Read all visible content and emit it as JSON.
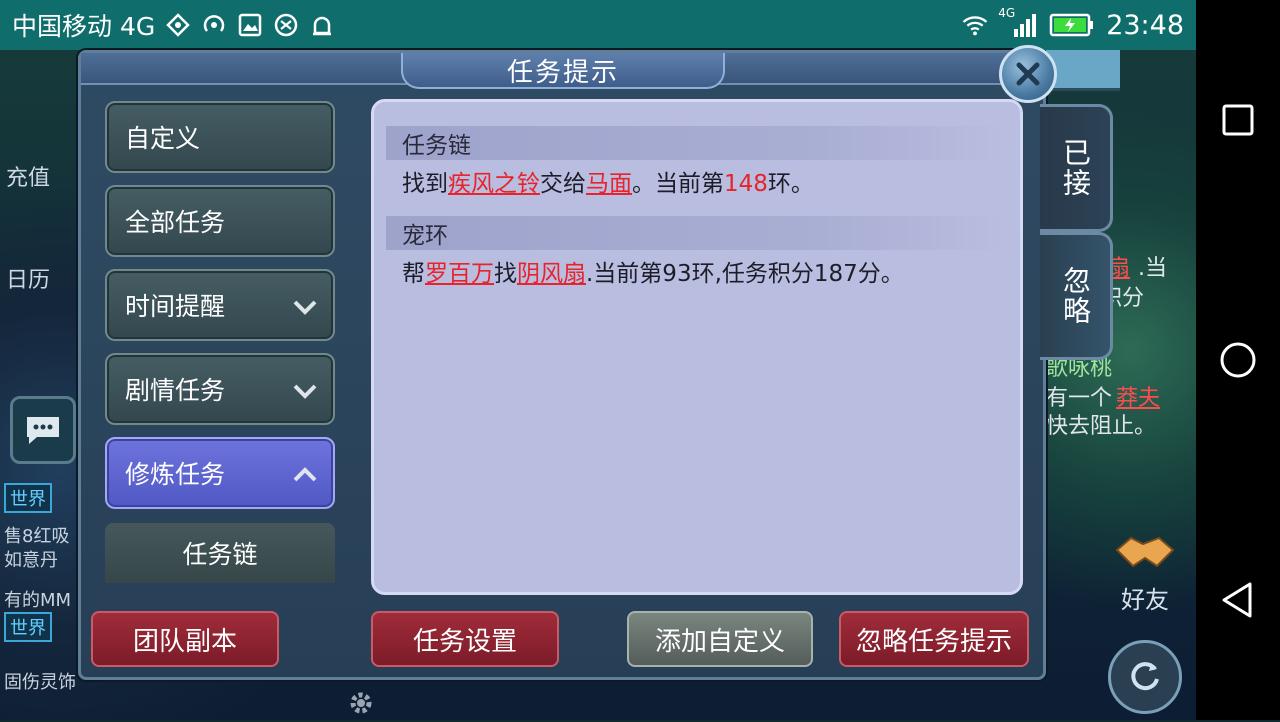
{
  "status_bar": {
    "carrier": "中国移动 4G",
    "network_badge": "4G",
    "time": "23:48",
    "icons": [
      "data-sync-icon",
      "hotspot-icon",
      "image-icon",
      "vpn-icon",
      "android-debug-icon",
      "wifi-icon",
      "signal-icon",
      "battery-charging-icon"
    ]
  },
  "dialog": {
    "title": "任务提示",
    "menu": {
      "custom": "自定义",
      "all_tasks": "全部任务",
      "time_reminder": "时间提醒",
      "story_tasks": "剧情任务",
      "cultivation_tasks": "修炼任务",
      "sub_task_chain": "任务链"
    },
    "sections": [
      {
        "head": "任务链",
        "parts": {
          "p1": "找到",
          "item": "疾风之铃",
          "p2": "交给",
          "npc": "马面",
          "p3": "。当前第",
          "num": "148",
          "p4": "环。"
        }
      },
      {
        "head": "宠环",
        "parts": {
          "p1": "帮",
          "npc": "罗百万",
          "p2": "找",
          "item": "阴风扇",
          "p3": ".当前第93环,任务积分187分。"
        }
      }
    ],
    "side_tabs": {
      "accepted": "已接",
      "ignored": "忽略"
    },
    "buttons": {
      "team_dungeon": "团队副本",
      "task_settings": "任务设置",
      "add_custom": "添加自定义",
      "ignore_hint": "忽略任务提示"
    }
  },
  "background": {
    "left": {
      "recharge": "充值",
      "calendar": "日历",
      "world": "世界",
      "chat1": "售8红吸",
      "chat2": "如意丹",
      "chat3": "有的MM",
      "chat4": "固伤灵饰"
    },
    "right": {
      "frag1_red": "扇",
      "frag1": ".当",
      "frag2": "积分",
      "frag3": "歌咏桃",
      "frag4": "有一个",
      "frag5_red": "莽夫",
      "frag6": "快去阻止。",
      "friend": "好友"
    }
  },
  "colors": {
    "status_bar": "#0f6e6b",
    "highlight_red": "#e8232b",
    "panel": "#b9bddf",
    "active_menu": "#5c63d0"
  }
}
